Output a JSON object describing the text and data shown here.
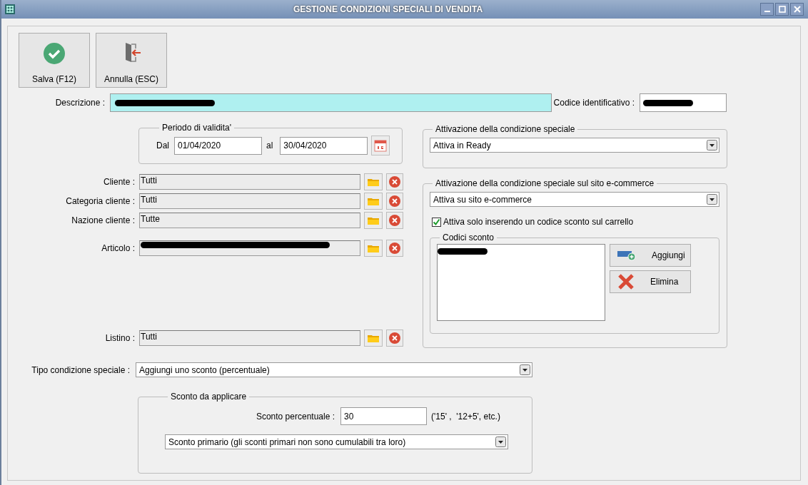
{
  "window": {
    "title": "GESTIONE CONDIZIONI SPECIALI DI VENDITA"
  },
  "toolbar": [
    {
      "kind": "save",
      "label": "Salva (F12)"
    },
    {
      "kind": "cancel",
      "label": "Annulla (ESC)"
    }
  ],
  "descrizione": {
    "label": "Descrizione :"
  },
  "codice": {
    "label": "Codice identificativo :"
  },
  "periodo": {
    "title": "Periodo di validita'",
    "from_label": "Dal",
    "from": "01/04/2020",
    "to_label": "al",
    "to": "30/04/2020"
  },
  "selectors": [
    {
      "kind": "single",
      "label": "Cliente :",
      "value": "Tutti"
    },
    {
      "kind": "single",
      "label": "Categoria cliente :",
      "value": "Tutti"
    },
    {
      "kind": "single",
      "label": "Nazione cliente :",
      "value": "Tutte"
    },
    {
      "kind": "redacted",
      "label": "Articolo :"
    },
    {
      "kind": "single",
      "label": "Listino :",
      "value": "Tutti"
    }
  ],
  "attivazione": {
    "title": "Attivazione della condizione speciale",
    "value": "Attiva in Ready"
  },
  "ecommerce": {
    "title": "Attivazione della condizione speciale sul sito e-commerce",
    "value": "Attiva su sito e-commerce",
    "checkbox": {
      "label": "Attiva solo inserendo un codice sconto sul carrello",
      "checked": true
    },
    "codici_title": "Codici sconto",
    "buttons": [
      {
        "kind": "add",
        "label": "Aggiungi"
      },
      {
        "kind": "delete",
        "label": "Elimina"
      }
    ]
  },
  "tipo": {
    "label": "Tipo condizione speciale :",
    "value": "Aggiungi uno sconto (percentuale)"
  },
  "sconto": {
    "title": "Sconto da applicare",
    "label": "Sconto percentuale :",
    "value": "30",
    "hint": "('15' ,  '12+5', etc.)",
    "mode": "Sconto primario (gli sconti primari non sono cumulabili tra loro)"
  }
}
